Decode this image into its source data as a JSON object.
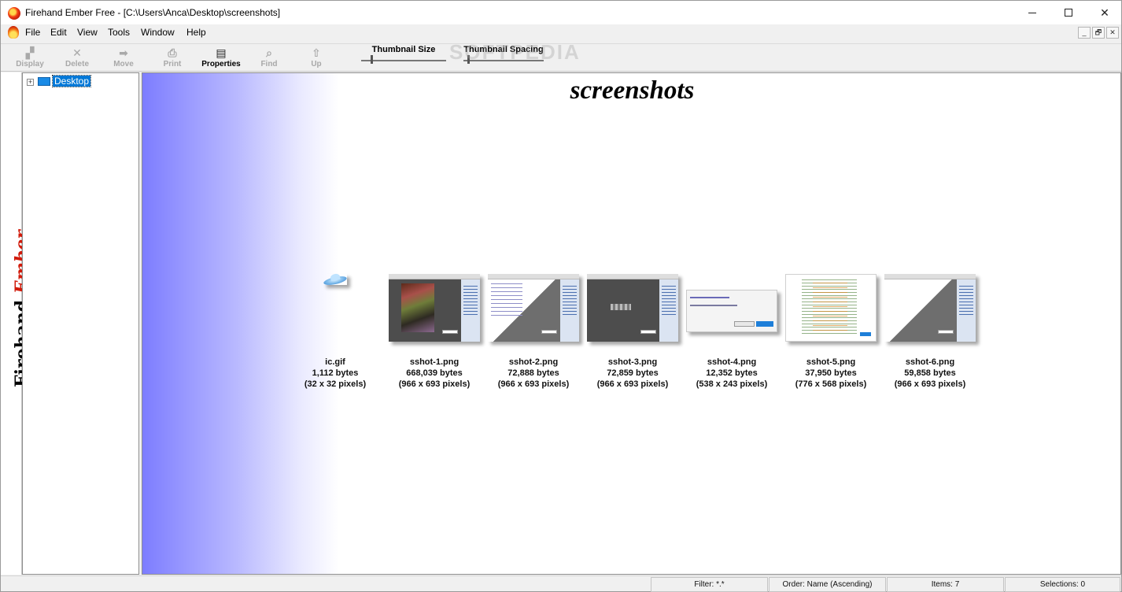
{
  "window": {
    "title": "Firehand Ember Free - [C:\\Users\\Anca\\Desktop\\screenshots]",
    "minimize_glyph": "—",
    "maximize_glyph": "☐",
    "close_glyph": "✕"
  },
  "menu": {
    "items": [
      "File",
      "Edit",
      "View",
      "Tools",
      "Window",
      "Help"
    ],
    "mdi_buttons": [
      "_",
      "🗗",
      "✕"
    ]
  },
  "toolbar": {
    "buttons": [
      {
        "label": "Display",
        "icon": "display-icon",
        "glyph": "▞",
        "enabled": false
      },
      {
        "label": "Delete",
        "icon": "delete-icon",
        "glyph": "✕",
        "enabled": false
      },
      {
        "label": "Move",
        "icon": "move-icon",
        "glyph": "➡",
        "enabled": false
      },
      {
        "label": "Print",
        "icon": "print-icon",
        "glyph": "⎙",
        "enabled": false
      },
      {
        "label": "Properties",
        "icon": "properties-icon",
        "glyph": "▤",
        "enabled": true
      },
      {
        "label": "Find",
        "icon": "find-icon",
        "glyph": "⌕",
        "enabled": false
      },
      {
        "label": "Up",
        "icon": "up-icon",
        "glyph": "⇧",
        "enabled": false
      }
    ],
    "thumbnail_size_label": "Thumbnail Size",
    "thumbnail_size_value": 0.1,
    "thumbnail_spacing_label": "Thumbnail Spacing",
    "thumbnail_spacing_value": 0.02
  },
  "watermark": "SOFTPEDIA",
  "brand": {
    "name_part1": "Firehand",
    "name_part2": "Ember"
  },
  "tree": {
    "expander": "+",
    "root_label": "Desktop"
  },
  "viewer": {
    "folder_title": "screenshots",
    "files": [
      {
        "name": "ic.gif",
        "size": "1,112 bytes",
        "dims": "(32 x 32 pixels)",
        "kind": "gif-icon"
      },
      {
        "name": "sshot-1.png",
        "size": "668,039 bytes",
        "dims": "(966 x 693 pixels)",
        "kind": "photo"
      },
      {
        "name": "sshot-2.png",
        "size": "72,888 bytes",
        "dims": "(966 x 693 pixels)",
        "kind": "list"
      },
      {
        "name": "sshot-3.png",
        "size": "72,859 bytes",
        "dims": "(966 x 693 pixels)",
        "kind": "dark"
      },
      {
        "name": "sshot-4.png",
        "size": "12,352 bytes",
        "dims": "(538 x 243 pixels)",
        "kind": "dialog"
      },
      {
        "name": "sshot-5.png",
        "size": "37,950 bytes",
        "dims": "(776 x 568 pixels)",
        "kind": "tree"
      },
      {
        "name": "sshot-6.png",
        "size": "59,858 bytes",
        "dims": "(966 x 693 pixels)",
        "kind": "plain"
      }
    ]
  },
  "status": {
    "filter": "Filter: *.*",
    "order": "Order: Name (Ascending)",
    "items": "Items: 7",
    "selections": "Selections: 0"
  },
  "colors": {
    "viewer_gradient_start": "#7d7dff",
    "tree_selection": "#0078d7",
    "brand_accent": "#d11a0a"
  }
}
